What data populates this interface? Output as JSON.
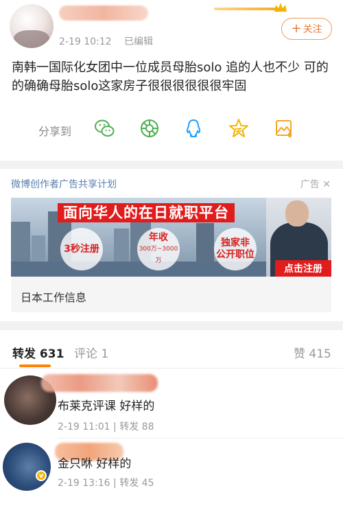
{
  "post": {
    "timestamp": "2-19 10:12",
    "edited": "已编辑",
    "follow_label": "关注",
    "content": "南韩一国际化女团中一位成员母胎solo 追的人也不少 可的的确确母胎solo这家房子很很很很很很牢固",
    "share_label": "分享到",
    "share_targets": [
      "wechat-icon",
      "moments-icon",
      "qq-icon",
      "qzone-icon",
      "save-image-icon"
    ],
    "colors": {
      "accent": "#ff8200",
      "follow": "#e8773a",
      "link": "#5a7fb0"
    }
  },
  "ad": {
    "sponsor_label": "微博创作者广告共享计划",
    "ad_tag": "广告",
    "banner_title": "面向华人的在日就职平台",
    "badge1": "3秒注册",
    "badge2_title": "年收",
    "badge2_sub": "300万~3000万",
    "badge3_line1": "独家非",
    "badge3_line2": "公开职位",
    "cta": "点击注册",
    "caption": "日本工作信息"
  },
  "tabs": {
    "repost_label": "转发",
    "repost_count": "631",
    "comment_label": "评论",
    "comment_count": "1",
    "like_label": "赞",
    "like_count": "415"
  },
  "reposts": [
    {
      "text": "布莱克评课 好样的",
      "timestamp": "2-19 11:01",
      "repost_label": "转发",
      "repost_count": "88"
    },
    {
      "text": "金只咻 好样的",
      "timestamp": "2-19 13:16",
      "repost_label": "转发",
      "repost_count": "45"
    }
  ]
}
